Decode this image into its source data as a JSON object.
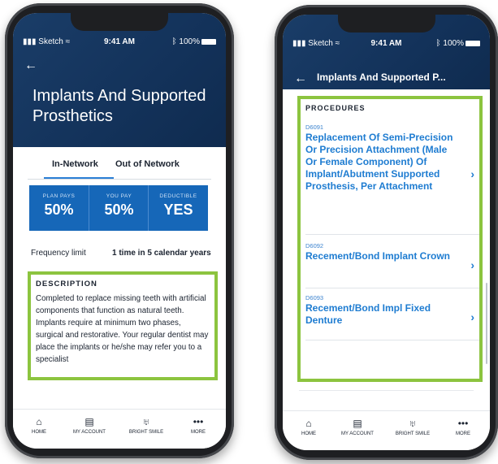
{
  "left": {
    "status": {
      "carrier": "Sketch",
      "time": "9:41 AM",
      "battery": "100%"
    },
    "back_icon": "←",
    "title": "Implants And Supported Prosthetics",
    "tabs": [
      {
        "label": "In-Network",
        "active": true
      },
      {
        "label": "Out of Network",
        "active": false
      }
    ],
    "stats": [
      {
        "label": "PLAN PAYS",
        "value": "50%"
      },
      {
        "label": "YOU PAY",
        "value": "50%"
      },
      {
        "label": "DEDUCTIBLE",
        "value": "YES"
      }
    ],
    "frequency": {
      "label": "Frequency limit",
      "value": "1 time in 5 calendar years"
    },
    "description": {
      "heading": "DESCRIPTION",
      "text": "Completed to replace missing teeth with artificial components that function as natural teeth. Implants require at minimum two phases, surgical and restorative. Your regular dentist may place the implants or he/she may refer you to a specialist"
    }
  },
  "right": {
    "status": {
      "carrier": "Sketch",
      "time": "9:41 AM",
      "battery": "100%"
    },
    "back_icon": "←",
    "title": "Implants And Supported P...",
    "procedures_heading": "PROCEDURES",
    "procedures": [
      {
        "code": "D6091",
        "name": "Replacement Of Semi-Precision Or Precision Attachment (Male Or Female Component) Of Implant/Abutment Supported Prosthesis, Per Attachment"
      },
      {
        "code": "D6092",
        "name": "Recement/Bond Implant Crown"
      },
      {
        "code": "D6093",
        "name": "Recement/Bond Impl Fixed Denture"
      }
    ],
    "chevron": "›"
  },
  "nav": [
    {
      "label": "HOME",
      "icon": "home-icon",
      "glyph": "⌂"
    },
    {
      "label": "MY ACCOUNT",
      "icon": "account-icon",
      "glyph": "▤"
    },
    {
      "label": "BRIGHT SMILE",
      "icon": "tooth-icon",
      "glyph": "♅"
    },
    {
      "label": "MORE",
      "icon": "more-icon",
      "glyph": "•••"
    }
  ],
  "colors": {
    "header": "#13325a",
    "accent": "#1e7cd1",
    "stats_bg": "#1667b8",
    "highlight": "#8cc43f"
  }
}
